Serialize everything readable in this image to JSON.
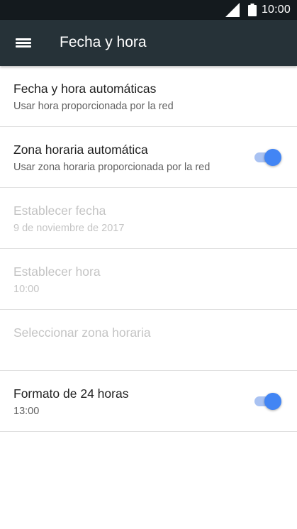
{
  "status_bar": {
    "time": "10:00"
  },
  "toolbar": {
    "title": "Fecha y hora"
  },
  "settings": [
    {
      "title": "Fecha y hora automáticas",
      "summary": "Usar hora proporcionada por la red",
      "enabled": true
    },
    {
      "title": "Zona horaria automática",
      "summary": "Usar zona horaria proporcionada por la red",
      "enabled": true,
      "toggle_on": true
    },
    {
      "title": "Establecer fecha",
      "summary": "9 de noviembre de 2017",
      "enabled": false
    },
    {
      "title": "Establecer hora",
      "summary": "10:00",
      "enabled": false
    },
    {
      "title": "Seleccionar zona horaria",
      "summary": "",
      "enabled": false
    },
    {
      "title": "Formato de 24 horas",
      "summary": "13:00",
      "enabled": true,
      "toggle_on": true
    }
  ],
  "colors": {
    "status_bar": "#141a1e",
    "toolbar": "#263238",
    "accent": "#4285f4",
    "accent_track": "#a9c2f2",
    "disabled_text": "#c4c4c4"
  },
  "icons": [
    "signal-icon",
    "battery-icon",
    "menu-icon"
  ]
}
